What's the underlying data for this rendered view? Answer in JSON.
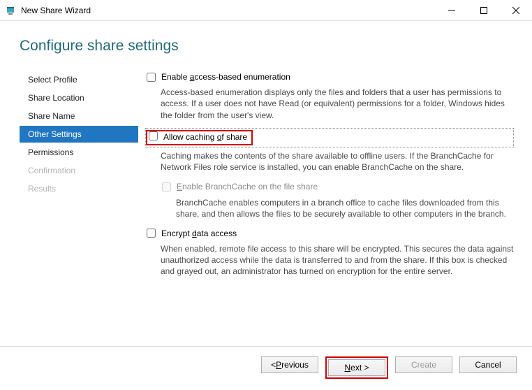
{
  "window": {
    "title": "New Share Wizard"
  },
  "heading": "Configure share settings",
  "nav": {
    "items": [
      {
        "label": "Select Profile",
        "state": "normal"
      },
      {
        "label": "Share Location",
        "state": "normal"
      },
      {
        "label": "Share Name",
        "state": "normal"
      },
      {
        "label": "Other Settings",
        "state": "active"
      },
      {
        "label": "Permissions",
        "state": "normal"
      },
      {
        "label": "Confirmation",
        "state": "dim"
      },
      {
        "label": "Results",
        "state": "dim"
      }
    ]
  },
  "options": {
    "abe": {
      "label_pre": "Enable ",
      "label_u": "a",
      "label_post": "ccess-based enumeration",
      "desc": "Access-based enumeration displays only the files and folders that a user has permissions to access. If a user does not have Read (or equivalent) permissions for a folder, Windows hides the folder from the user's view."
    },
    "cache": {
      "label_pre": "Allow caching ",
      "label_u": "o",
      "label_post": "f share",
      "desc": "Caching makes the contents of the share available to offline users. If the BranchCache for Network Files role service is installed, you can enable BranchCache on the share."
    },
    "branch": {
      "label_pre": "",
      "label_u": "E",
      "label_post": "nable BranchCache on the file share",
      "desc": "BranchCache enables computers in a branch office to cache files downloaded from this share, and then allows the files to be securely available to other computers in the branch."
    },
    "encrypt": {
      "label_pre": "Encrypt ",
      "label_u": "d",
      "label_post": "ata access",
      "desc": "When enabled, remote file access to this share will be encrypted. This secures the data against unauthorized access while the data is transferred to and from the share. If this box is checked and grayed out, an administrator has turned on encryption for the entire server."
    }
  },
  "footer": {
    "previous_pre": "< ",
    "previous_u": "P",
    "previous_post": "revious",
    "next_u": "N",
    "next_post": "ext >",
    "create": "Create",
    "cancel": "Cancel"
  }
}
